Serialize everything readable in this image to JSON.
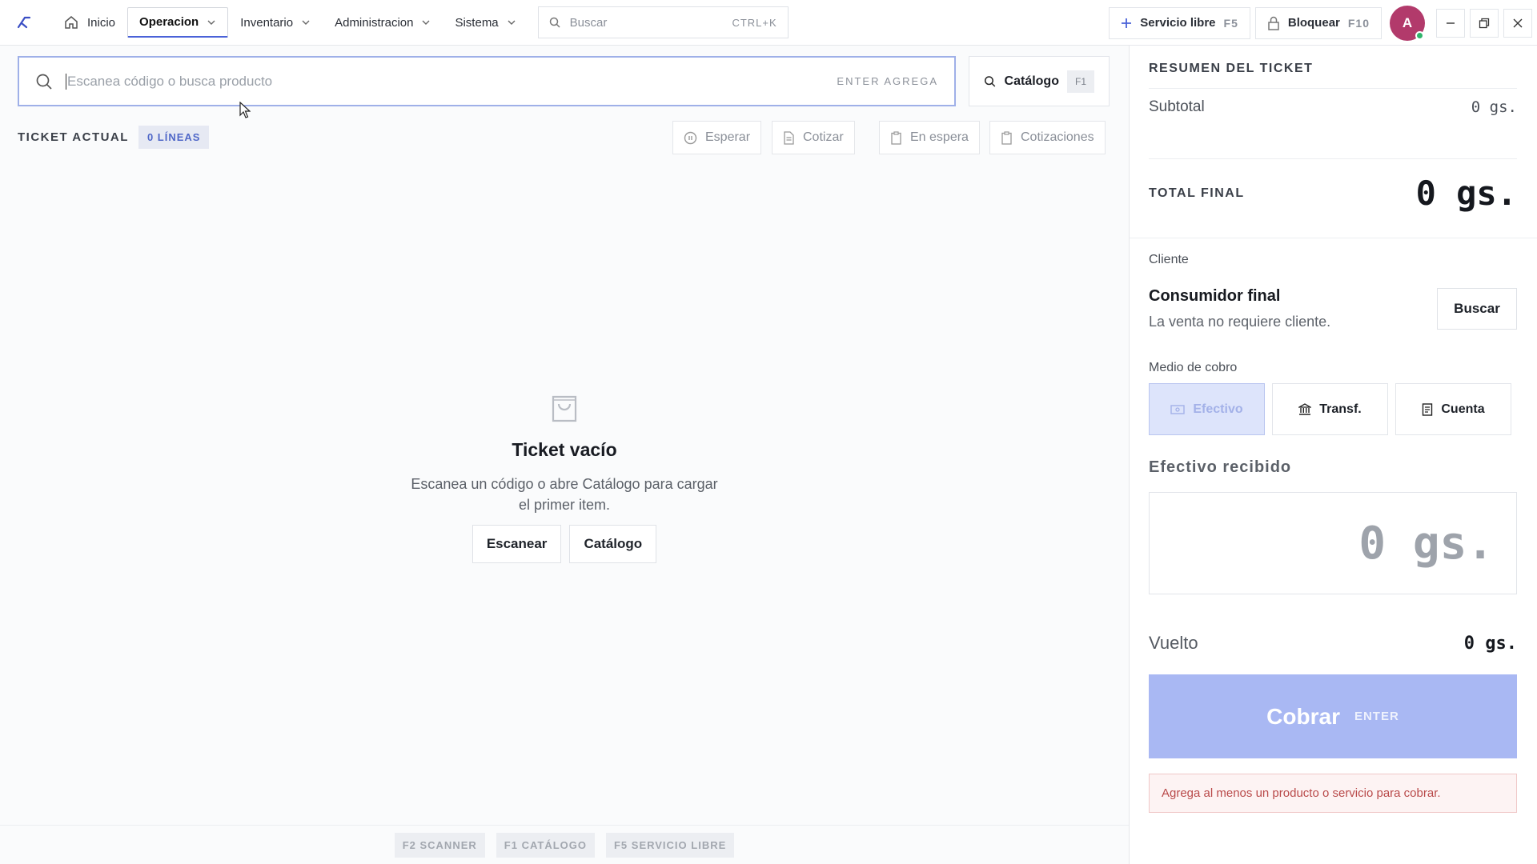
{
  "topbar": {
    "nav": [
      {
        "label": "Inicio"
      },
      {
        "label": "Operacion"
      },
      {
        "label": "Inventario"
      },
      {
        "label": "Administracion"
      },
      {
        "label": "Sistema"
      }
    ],
    "search_placeholder": "Buscar",
    "search_shortcut": "CTRL+K",
    "servicio_label": "Servicio libre",
    "servicio_key": "F5",
    "bloquear_label": "Bloquear",
    "bloquear_key": "F10",
    "avatar_initial": "A"
  },
  "scan": {
    "placeholder": "Escanea código o busca producto",
    "hint": "ENTER AGREGA",
    "catalog_label": "Catálogo",
    "catalog_key": "F1"
  },
  "ticket": {
    "label": "TICKET ACTUAL",
    "lines": "0 LÍNEAS",
    "actions": {
      "esperar": "Esperar",
      "cotizar": "Cotizar",
      "en_espera": "En espera",
      "cotizaciones": "Cotizaciones"
    }
  },
  "empty": {
    "title": "Ticket vacío",
    "text_line1": "Escanea un código o abre Catálogo para cargar",
    "text_line2": "el primer item.",
    "scan_button": "Escanear",
    "catalog_button": "Catálogo"
  },
  "footer_keys": {
    "scanner": "F2 SCANNER",
    "catalogo": "F1 CATÁLOGO",
    "servicio": "F5 SERVICIO LIBRE"
  },
  "summary": {
    "title": "RESUMEN DEL TICKET",
    "subtotal_label": "Subtotal",
    "subtotal_value": "0 gs.",
    "total_label": "TOTAL FINAL",
    "total_value": "0 gs.",
    "client_label": "Cliente",
    "client_name": "Consumidor final",
    "client_sub": "La venta no requiere cliente.",
    "client_search": "Buscar",
    "payment_label": "Medio de cobro",
    "payment": {
      "efectivo": "Efectivo",
      "transf": "Transf.",
      "cuenta": "Cuenta"
    },
    "cash_label": "Efectivo recibido",
    "cash_value": "0 gs.",
    "change_label": "Vuelto",
    "change_value": "0 gs.",
    "charge_label": "Cobrar",
    "charge_key": "ENTER",
    "alert": "Agrega al menos un producto o servicio para cobrar."
  },
  "colors": {
    "accent": "#4a62d8",
    "charge_button": "#a9b8f3",
    "avatar": "#b23a6b",
    "alert_text": "#b94a4a"
  }
}
